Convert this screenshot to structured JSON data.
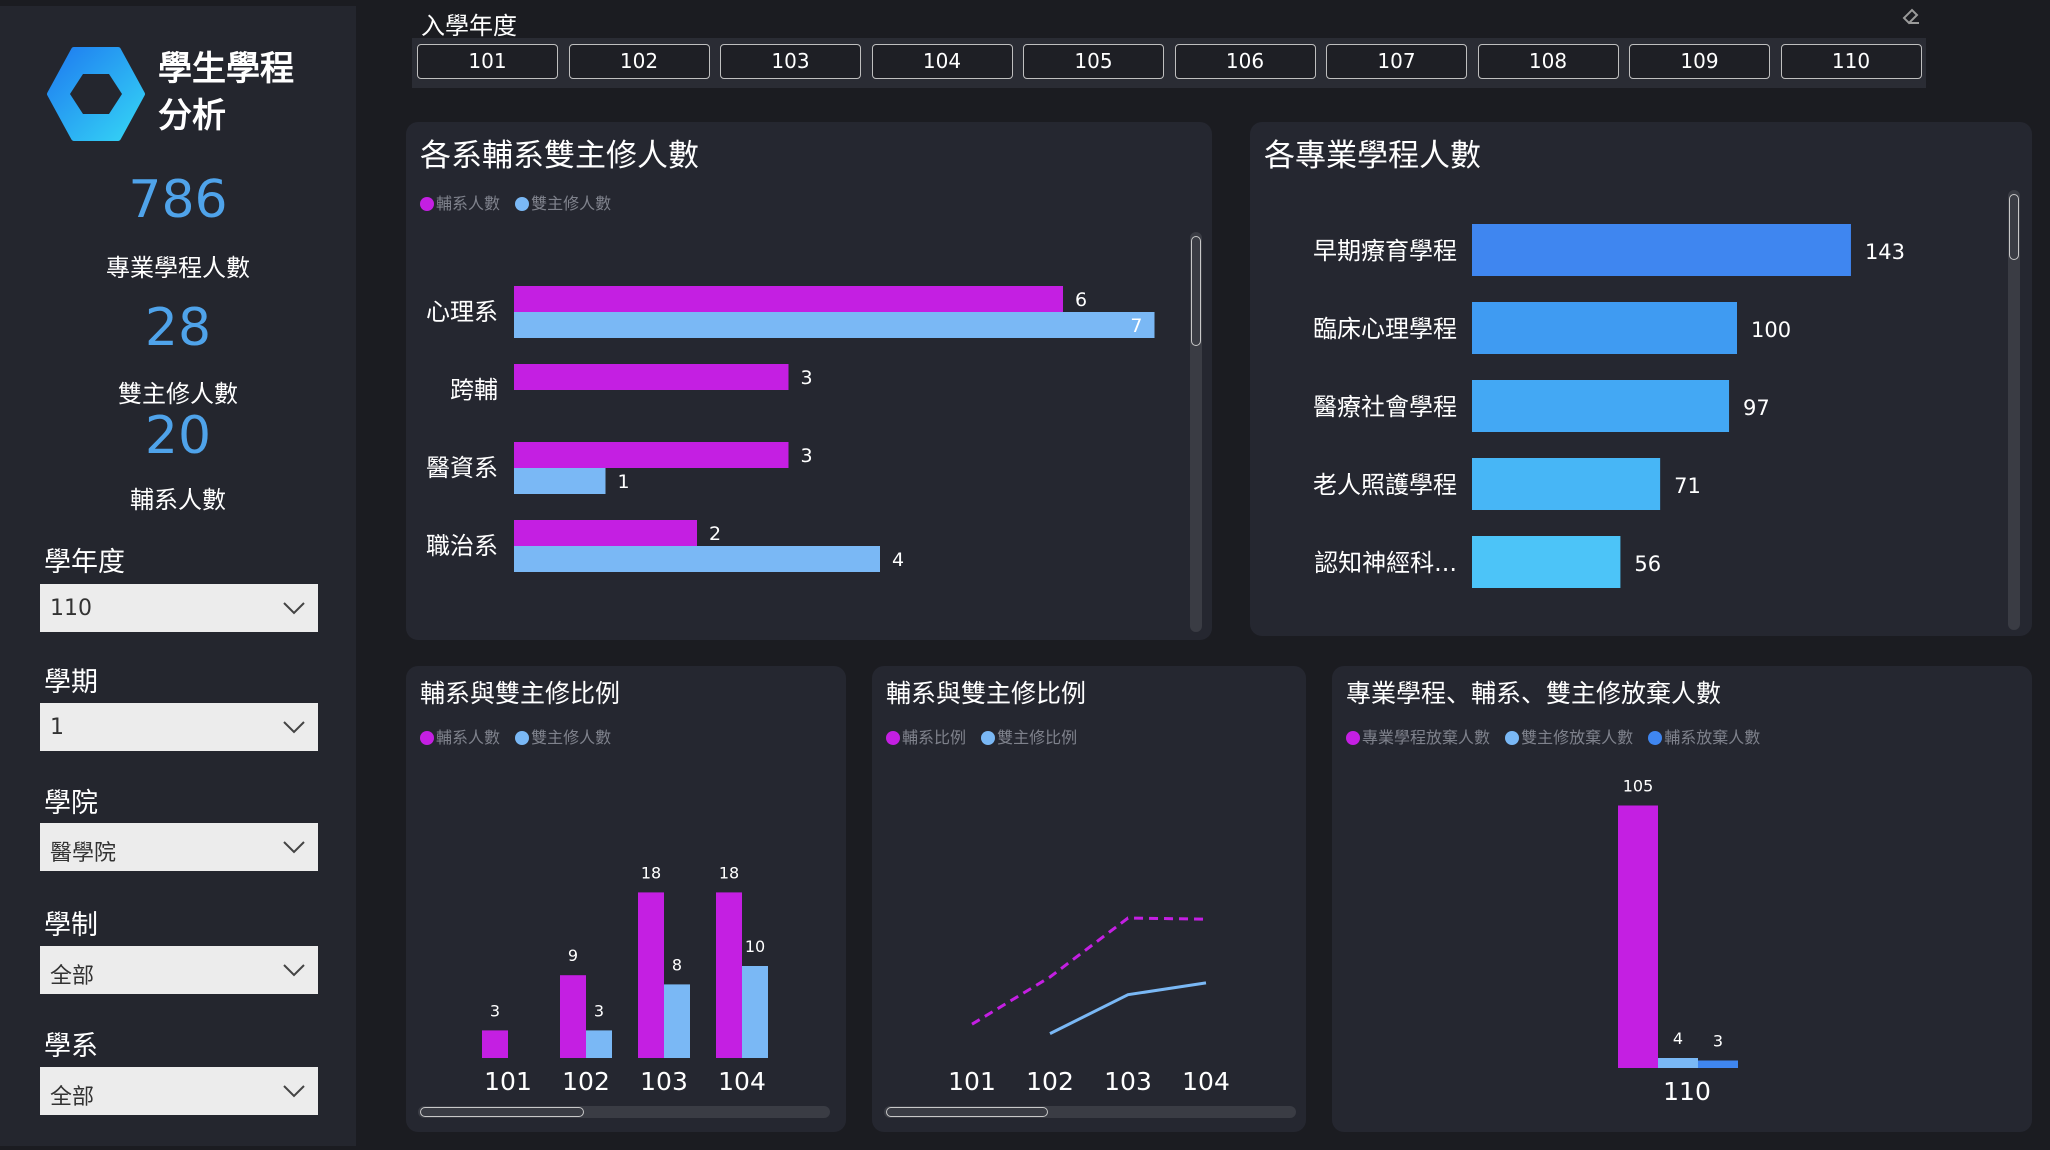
{
  "app": {
    "title_line1": "學生學程",
    "title_line2": "分析"
  },
  "kpis": [
    {
      "value": "786",
      "label": "專業學程人數"
    },
    {
      "value": "28",
      "label": "雙主修人數"
    },
    {
      "value": "20",
      "label": "輔系人數"
    }
  ],
  "filters": [
    {
      "label": "學年度",
      "value": "110"
    },
    {
      "label": "學期",
      "value": "1"
    },
    {
      "label": "學院",
      "value": "醫學院"
    },
    {
      "label": "學制",
      "value": "全部"
    },
    {
      "label": "學系",
      "value": "全部"
    }
  ],
  "year_slicer": {
    "title": "入學年度",
    "options": [
      "101",
      "102",
      "103",
      "104",
      "105",
      "106",
      "107",
      "108",
      "109",
      "110"
    ]
  },
  "colors": {
    "magenta": "#c41fe2",
    "light_blue": "#7ab8f5",
    "blue": "#3f86f0"
  },
  "icons": {
    "logo": "hexagon-logo-icon",
    "dropdown": "chevron-down-icon",
    "eraser": "eraser-icon"
  },
  "chart_data": [
    {
      "type": "bar",
      "orientation": "horizontal",
      "title": "各系輔系雙主修人數",
      "legend_position": "top-left",
      "categories": [
        "心理系",
        "跨輔",
        "醫資系",
        "職治系"
      ],
      "series": [
        {
          "name": "輔系人數",
          "color": "#c41fe2",
          "values": [
            6,
            3,
            3,
            2
          ]
        },
        {
          "name": "雙主修人數",
          "color": "#7ab8f5",
          "values": [
            7,
            null,
            1,
            4
          ]
        }
      ]
    },
    {
      "type": "bar",
      "orientation": "horizontal",
      "title": "各專業學程人數",
      "categories": [
        "早期療育學程",
        "臨床心理學程",
        "醫療社會學程",
        "老人照護學程",
        "認知神經科..."
      ],
      "values": [
        143,
        100,
        97,
        71,
        56
      ],
      "colors": [
        "#3f86f0",
        "#3f9bf2",
        "#43a8f4",
        "#47b6f6",
        "#4cc4f8"
      ]
    },
    {
      "type": "bar",
      "title": "輔系與雙主修比例",
      "legend_position": "top-left",
      "categories": [
        "101",
        "102",
        "103",
        "104"
      ],
      "series": [
        {
          "name": "輔系人數",
          "color": "#c41fe2",
          "values": [
            3,
            9,
            18,
            18
          ]
        },
        {
          "name": "雙主修人數",
          "color": "#7ab8f5",
          "values": [
            null,
            3,
            8,
            10
          ]
        }
      ]
    },
    {
      "type": "line",
      "title": "輔系與雙主修比例",
      "legend_position": "top-left",
      "categories": [
        "101",
        "102",
        "103",
        "104"
      ],
      "series": [
        {
          "name": "輔系比例",
          "color": "#c41fe2",
          "style": "dashed",
          "values": [
            0.1,
            0.5,
            1.0,
            0.99
          ]
        },
        {
          "name": "雙主修比例",
          "color": "#7ab8f5",
          "style": "solid",
          "values": [
            null,
            0.02,
            0.35,
            0.45
          ]
        }
      ]
    },
    {
      "type": "bar",
      "title": "專業學程、輔系、雙主修放棄人數",
      "legend_position": "top-left",
      "categories": [
        "110"
      ],
      "series": [
        {
          "name": "專業學程放棄人數",
          "color": "#c41fe2",
          "values": [
            105
          ]
        },
        {
          "name": "雙主修放棄人數",
          "color": "#7ab8f5",
          "values": [
            4
          ]
        },
        {
          "name": "輔系放棄人數",
          "color": "#3f86f0",
          "values": [
            3
          ]
        }
      ]
    }
  ]
}
